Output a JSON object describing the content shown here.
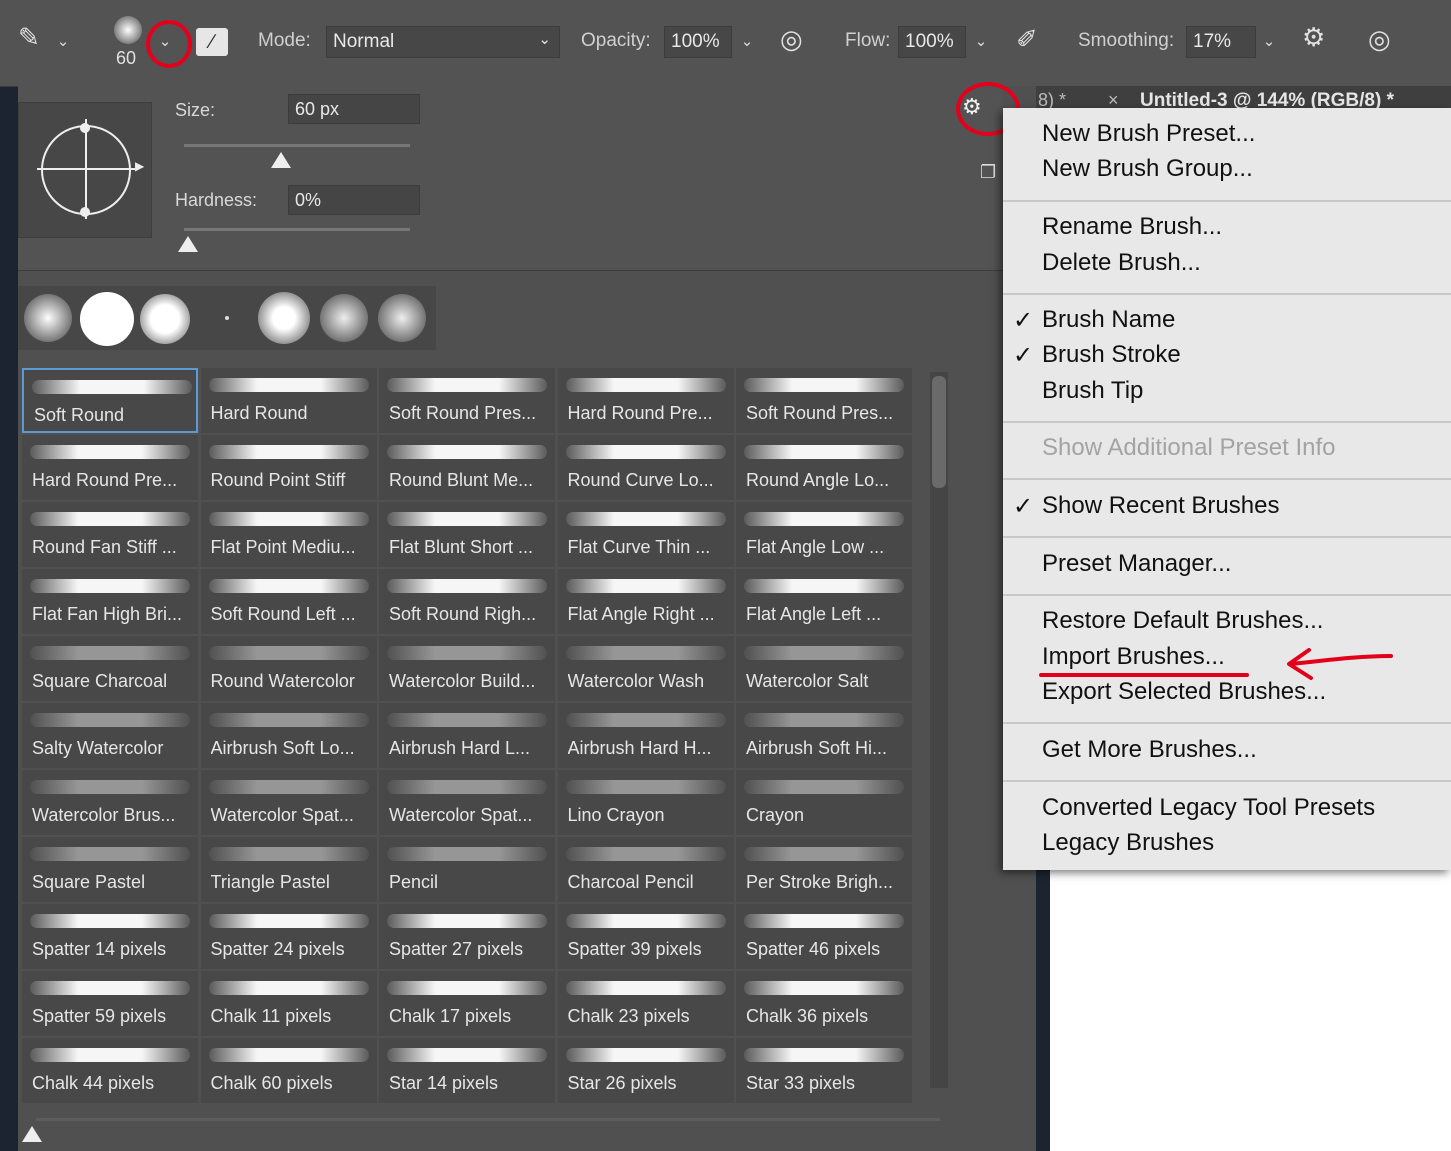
{
  "options_bar": {
    "brush_size_value": "60",
    "mode_label": "Mode:",
    "mode_value": "Normal",
    "opacity_label": "Opacity:",
    "opacity_value": "100%",
    "flow_label": "Flow:",
    "flow_value": "100%",
    "smoothing_label": "Smoothing:",
    "smoothing_value": "17%"
  },
  "brush_settings": {
    "size_label": "Size:",
    "size_value": "60 px",
    "hardness_label": "Hardness:",
    "hardness_value": "0%",
    "size_slider_level": 0.43,
    "hardness_slider_level": 0.0
  },
  "document_tabs": {
    "tab1": "8) *",
    "tab2": "Untitled-3 @ 144% (RGB/8) *",
    "close_glyph": "×"
  },
  "brush_grid": [
    [
      "Soft Round",
      "Hard Round",
      "Soft Round Pres...",
      "Hard Round Pre...",
      "Soft Round Pres..."
    ],
    [
      "Hard Round Pre...",
      "Round Point Stiff",
      "Round Blunt Me...",
      "Round Curve Lo...",
      "Round Angle Lo..."
    ],
    [
      "Round Fan Stiff ...",
      "Flat Point Mediu...",
      "Flat Blunt Short ...",
      "Flat Curve Thin ...",
      "Flat Angle Low ..."
    ],
    [
      "Flat Fan High Bri...",
      "Soft Round Left ...",
      "Soft Round Righ...",
      "Flat Angle Right ...",
      "Flat Angle Left ..."
    ],
    [
      "Square Charcoal",
      "Round Watercolor",
      "Watercolor Build...",
      "Watercolor Wash",
      "Watercolor Salt"
    ],
    [
      "Salty Watercolor",
      "Airbrush Soft Lo...",
      "Airbrush Hard L...",
      "Airbrush Hard H...",
      "Airbrush Soft Hi..."
    ],
    [
      "Watercolor Brus...",
      "Watercolor Spat...",
      "Watercolor Spat...",
      "Lino Crayon",
      "Crayon"
    ],
    [
      "Square Pastel",
      "Triangle Pastel",
      "Pencil",
      "Charcoal Pencil",
      "Per Stroke Brigh..."
    ],
    [
      "Spatter 14 pixels",
      "Spatter 24 pixels",
      "Spatter 27 pixels",
      "Spatter 39 pixels",
      "Spatter 46 pixels"
    ],
    [
      "Spatter 59 pixels",
      "Chalk 11 pixels",
      "Chalk 17 pixels",
      "Chalk 23 pixels",
      "Chalk 36 pixels"
    ],
    [
      "Chalk 44 pixels",
      "Chalk 60 pixels",
      "Star 14 pixels",
      "Star 26 pixels",
      "Star 33 pixels"
    ]
  ],
  "menu": {
    "new_brush_preset": "New Brush Preset...",
    "new_brush_group": "New Brush Group...",
    "rename_brush": "Rename Brush...",
    "delete_brush": "Delete Brush...",
    "brush_name": "Brush Name",
    "brush_stroke": "Brush Stroke",
    "brush_tip": "Brush Tip",
    "show_additional": "Show Additional Preset Info",
    "show_recent": "Show Recent Brushes",
    "preset_manager": "Preset Manager...",
    "restore_default": "Restore Default Brushes...",
    "import_brushes": "Import Brushes...",
    "export_selected": "Export Selected Brushes...",
    "get_more": "Get More Brushes...",
    "converted_legacy": "Converted Legacy Tool Presets",
    "legacy_brushes": "Legacy Brushes",
    "check_glyph": "✓"
  },
  "colors": {
    "annotation_red": "#e3001b",
    "selection_blue": "#5b9bd5",
    "panel_bg": "#505050",
    "menu_bg": "#e8e8e8"
  },
  "icons": [
    "brush-tool-icon",
    "chevron-down-icon",
    "brush-settings-toggle-icon",
    "pressure-opacity-icon",
    "airbrush-icon",
    "gear-icon",
    "pressure-size-icon",
    "panel-gear-icon",
    "new-preset-icon"
  ]
}
